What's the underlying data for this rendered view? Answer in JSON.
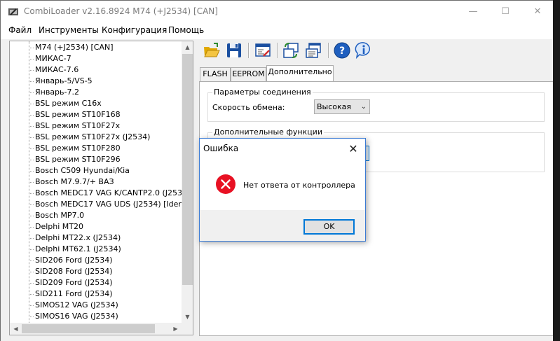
{
  "window": {
    "title": "CombiLoader v2.16.8924 M74 (+J2534) [CAN]",
    "minimize_glyph": "—",
    "maximize_glyph": "☐",
    "close_glyph": "✕"
  },
  "menu": [
    "Файл",
    "Инструменты",
    "Конфигурация",
    "Помощь"
  ],
  "tree": {
    "items": [
      "M74 (+J2534) [CAN]",
      "МИКАС-7",
      "МИКАС-7.6",
      "Январь-5/VS-5",
      "Январь-7.2",
      "BSL режим C16x",
      "BSL режим ST10F168",
      "BSL режим ST10F27x",
      "BSL режим ST10F27x (J2534)",
      "BSL режим ST10F280",
      "BSL режим ST10F296",
      "Bosch C509 Hyundai/Kia",
      "Bosch M7.9.7/+ ВАЗ",
      "Bosch MEDC17 VAG K/CANTP2.0 (J2534) [Id",
      "Bosch MEDC17 VAG UDS (J2534) [Ident]",
      "Bosch MP7.0",
      "Delphi MT20",
      "Delphi MT22.x (J2534)",
      "Delphi MT62.1 (J2534)",
      "SID206 Ford (J2534)",
      "SID208 Ford (J2534)",
      "SID209 Ford (J2534)",
      "SID211 Ford (J2534)",
      "SIMOS12 VAG (J2534)",
      "SIMOS16 VAG (J2534)"
    ]
  },
  "toolbar": {
    "icons": [
      "open-folder-icon",
      "save-disk-icon",
      "settings-window-icon",
      "read-write-icon",
      "ecu-window-icon",
      "help-icon",
      "info-icon"
    ]
  },
  "tabs": [
    "FLASH",
    "EEPROM",
    "Дополнительно"
  ],
  "connection": {
    "group_title": "Параметры соединения",
    "speed_label": "Скорость обмена:",
    "speed_value": "Высокая"
  },
  "extra": {
    "group_title": "Дополнительные функции"
  },
  "dialog": {
    "title": "Ошибка",
    "message": "Нет ответа от контроллера",
    "ok_label": "OK",
    "close_glyph": "✕"
  },
  "colors": {
    "accent": "#0078d7",
    "error_red": "#e81123",
    "folder_yellow": "#f4c542",
    "help_blue": "#1f5fbf"
  }
}
